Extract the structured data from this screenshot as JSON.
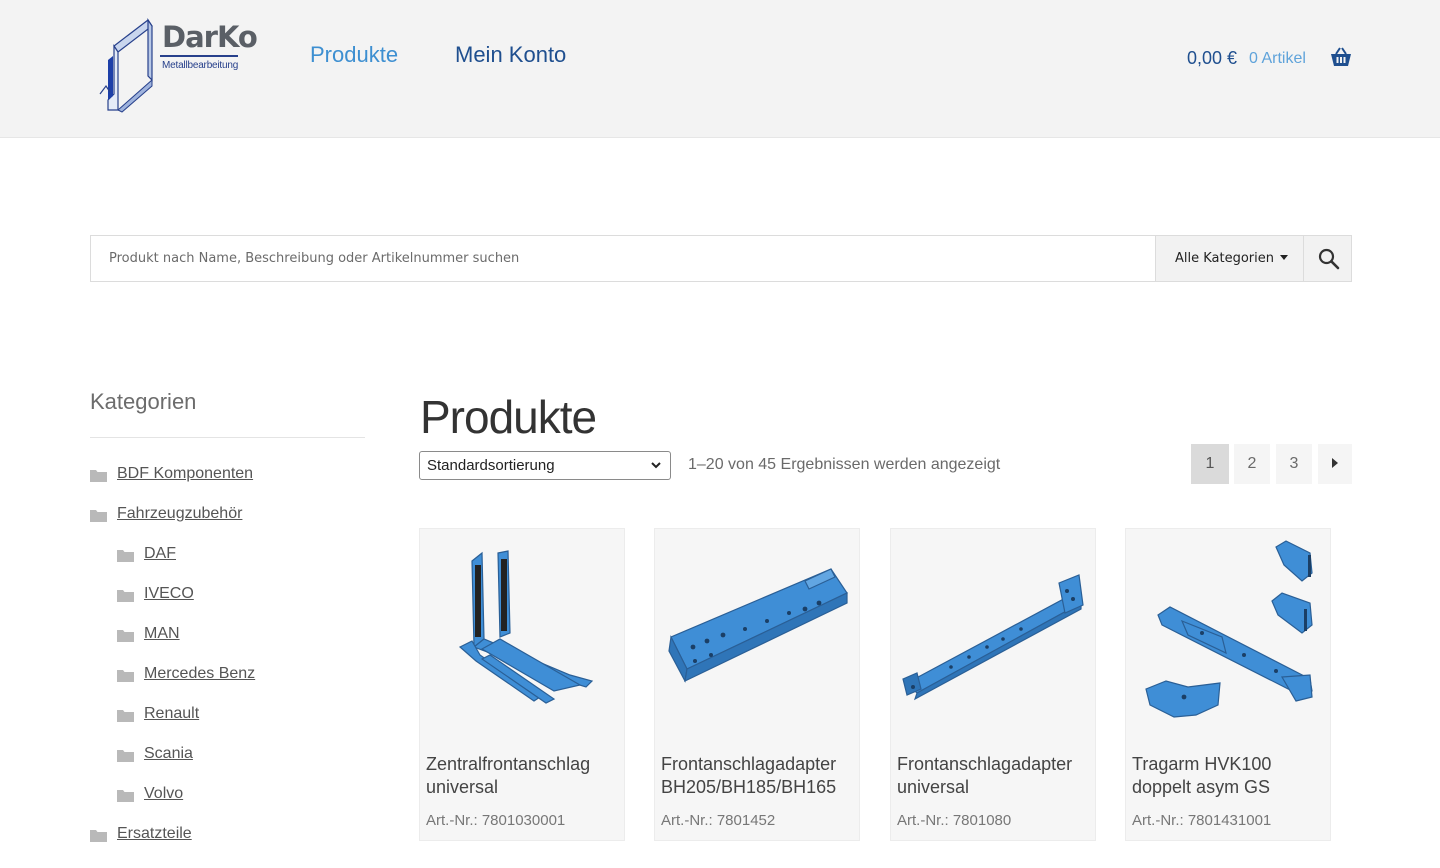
{
  "brand": {
    "name": "DarKo",
    "tagline": "Metallbearbeitung"
  },
  "nav": {
    "produkte": "Produkte",
    "konto": "Mein Konto"
  },
  "cart": {
    "total": "0,00 €",
    "count": "0 Artikel"
  },
  "search": {
    "placeholder": "Produkt nach Name, Beschreibung oder Artikelnummer suchen",
    "category": "Alle Kategorien"
  },
  "sidebar": {
    "title": "Kategorien",
    "items": [
      {
        "label": "BDF Komponenten",
        "level": 0
      },
      {
        "label": "Fahrzeugzubehör",
        "level": 0
      },
      {
        "label": "DAF",
        "level": 1
      },
      {
        "label": "IVECO",
        "level": 1
      },
      {
        "label": "MAN",
        "level": 1
      },
      {
        "label": "Mercedes Benz",
        "level": 1
      },
      {
        "label": "Renault",
        "level": 1
      },
      {
        "label": "Scania",
        "level": 1
      },
      {
        "label": "Volvo",
        "level": 1
      },
      {
        "label": "Ersatzteile",
        "level": 0
      }
    ]
  },
  "main": {
    "title": "Produkte",
    "sort": "Standardsortierung",
    "result_count": "1–20 von 45 Ergebnissen werden angezeigt",
    "pages": [
      "1",
      "2",
      "3"
    ],
    "current_page": "1"
  },
  "products": [
    {
      "name": "Zentralfrontanschlag universal",
      "sku": "Art.-Nr.: 7801030001"
    },
    {
      "name": "Frontanschlagadapter BH205/BH185/BH165",
      "sku": "Art.-Nr.: 7801452"
    },
    {
      "name": "Frontanschlagadapter universal",
      "sku": "Art.-Nr.: 7801080"
    },
    {
      "name": "Tragarm HVK100 doppelt asym GS",
      "sku": "Art.-Nr.: 7801431001"
    }
  ],
  "colors": {
    "accent": "#3d8fd1",
    "nav_dark": "#1f4f8f",
    "part_blue": "#3f8ed6"
  }
}
